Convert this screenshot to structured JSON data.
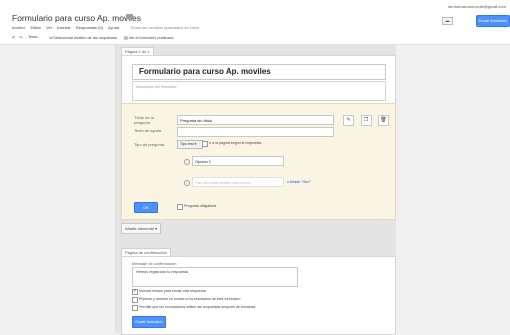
{
  "header": {
    "title": "Formulario para curso Ap. moviles",
    "user_email": "denformacionmovile@gmail.com",
    "view_button": "Enviar formulario",
    "comment_icon": "comment-icon"
  },
  "menu": {
    "items": [
      "Archivo",
      "Editar",
      "Ver",
      "Insertar",
      "Respuestas (0)",
      "Ayuda"
    ],
    "saved_note": "Todos los cambios guardados en Drive"
  },
  "toolbar": {
    "theme": "Tema...",
    "destination": "Seleccionar destino de las respuestas",
    "published": "Ver el formulario publicado"
  },
  "page": {
    "tag": "Página 1 de 1",
    "form_title": "Formulario para curso Ap. moviles",
    "desc_placeholder": "Descripción del formulario"
  },
  "question": {
    "title_label": "Título de la pregunta",
    "title_value": "Pregunta sin título",
    "help_label": "Texto de ayuda",
    "type_label": "Tipo de pregunta",
    "type_value": "Tipo test",
    "goto_label": "Ir a la página según la respuesta",
    "option1": "Opción 1",
    "option_placeholder": "Haz clic para añadir una opción",
    "add_other": "o Añadir \"Otro\"",
    "ok_button": "OK",
    "required_label": "Pregunta obligatoria"
  },
  "add_item": {
    "label": "Añadir elemento"
  },
  "confirmation": {
    "tag": "Página de confirmación",
    "message_label": "Mensaje de confirmación",
    "message_value": "Hemos registrado tu respuesta.",
    "opt1": "Mostrar enlace para enviar otra respuesta",
    "opt2": "Publicar y mostrar un enlace a los resultados de este formulario",
    "opt3": "Permitir que los encuestados editen las respuestas después de enviarlas",
    "send_button": "Enviar formulario"
  },
  "colors": {
    "accent": "#4d90fe",
    "question_bg": "#fbf6e3"
  }
}
